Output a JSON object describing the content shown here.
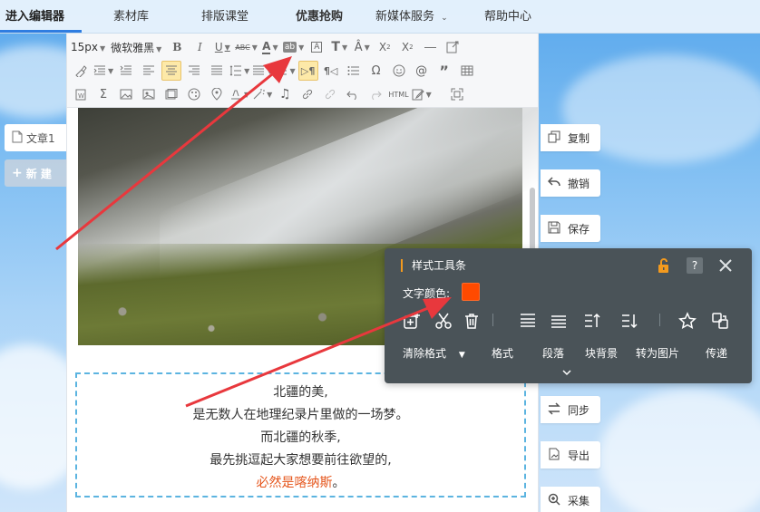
{
  "nav": {
    "items": [
      {
        "label": "进入编辑器"
      },
      {
        "label": "素材库"
      },
      {
        "label": "排版课堂"
      },
      {
        "label": "优惠抢购"
      },
      {
        "label": "新媒体服务"
      },
      {
        "label": "帮助中心"
      }
    ]
  },
  "left_panel": {
    "doc_tab": "文章1",
    "new_button": "新 建"
  },
  "toolbar": {
    "font_size": "15px",
    "font_family": "微软雅黑",
    "icons_row1": [
      "bold-icon",
      "italic-icon",
      "underline-icon",
      "strikethrough-icon",
      "font-color-icon",
      "background-color-icon",
      "border-text-icon",
      "text-size-icon",
      "text-scale-icon",
      "superscript-icon",
      "subscript-icon",
      "horizontal-rule-icon",
      "edit-link-icon"
    ],
    "icons_row2": [
      "format-brush-icon",
      "indent-icon",
      "line-indent-icon",
      "align-left-icon",
      "align-center-icon",
      "align-right-icon",
      "align-justify-icon",
      "line-height-icon",
      "letter-spacing-icon",
      "paragraph-spacing-icon",
      "ltr-icon",
      "rtl-icon",
      "list-icon",
      "special-char-icon",
      "emoji-icon",
      "at-icon",
      "quote-icon",
      "table-icon"
    ],
    "icons_row3": [
      "paste-word-icon",
      "sum-icon",
      "image-icon",
      "photo-icon",
      "gallery-icon",
      "location-icon",
      "clear-format-icon",
      "magic-icon",
      "music-icon",
      "link-icon",
      "unlink-icon",
      "undo-icon",
      "redo-icon",
      "html-icon",
      "edit-icon",
      "fullscreen-icon"
    ]
  },
  "article": {
    "lines": [
      "北疆的美,",
      "是无数人在地理纪录片里做的一场梦。",
      "而北疆的秋季,",
      "最先挑逗起大家想要前往欲望的,"
    ],
    "highlight_line": "必然是喀纳斯",
    "highlight_tail": "。"
  },
  "side_actions": [
    {
      "label": "复制",
      "icon": "copy-icon"
    },
    {
      "label": "撤销",
      "icon": "undo-icon"
    },
    {
      "label": "保存",
      "icon": "save-icon"
    },
    {
      "label": "同步",
      "icon": "sync-icon"
    },
    {
      "label": "导出",
      "icon": "export-icon"
    },
    {
      "label": "采集",
      "icon": "collect-icon"
    }
  ],
  "style_panel": {
    "title": "样式工具条",
    "help": "?",
    "text_color_label": "文字颜色:",
    "text_color": "#ff4a00",
    "labels": [
      "清除格式",
      "格式",
      "段落",
      "块背景",
      "转为图片",
      "传递"
    ]
  },
  "colors": {
    "accent": "#2f7de1",
    "highlight_text": "#e5541a",
    "panel_bg": "#4a5358",
    "annotation_arrow": "#e8383d"
  }
}
